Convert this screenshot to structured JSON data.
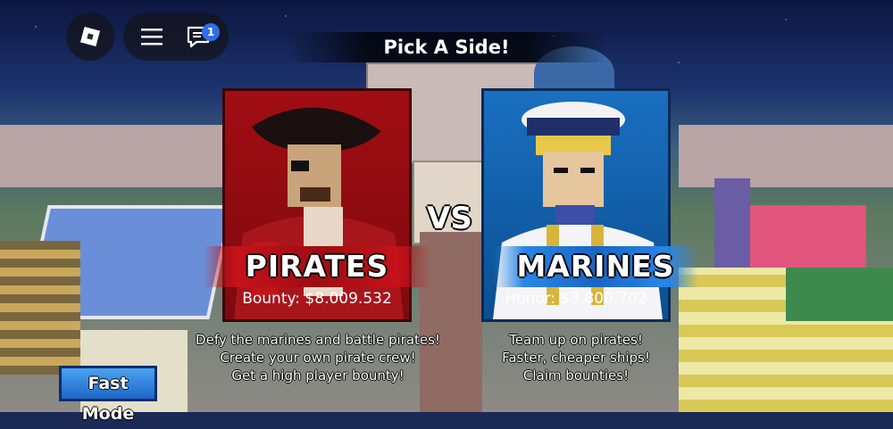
{
  "topbar": {
    "chat_badge_count": "1",
    "icons": [
      "roblox-logo-icon",
      "hamburger-menu-icon",
      "chat-icon"
    ]
  },
  "title": "Pick A Side!",
  "vs_label": "VS",
  "teams": {
    "pirates": {
      "name": "PIRATES",
      "stat": "Bounty: $8.009.532",
      "description": [
        "Defy the marines and battle pirates!",
        "Create your own pirate crew!",
        "Get a high player bounty!"
      ],
      "color": "#b80f16"
    },
    "marines": {
      "name": "MARINES",
      "stat": "Honor: $3.800.702",
      "description": [
        "Team up on pirates!",
        "Faster, cheaper ships!",
        "Claim bounties!"
      ],
      "color": "#1a6fc0"
    }
  },
  "fast_mode_label": "Fast Mode"
}
